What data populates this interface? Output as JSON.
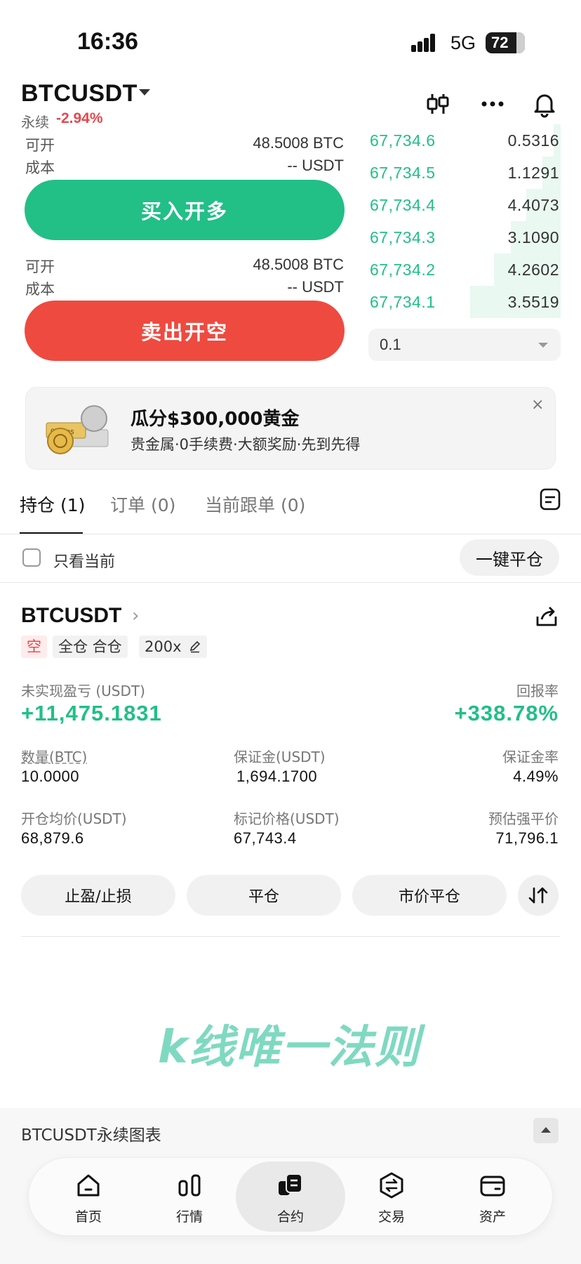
{
  "status_bar": {
    "time": "16:36",
    "network": "5G",
    "battery": "72"
  },
  "header": {
    "pair": "BTCUSDT",
    "contract_type": "永续",
    "change": "-2.94%"
  },
  "order_panel": {
    "buy": {
      "open_label": "可开",
      "open_value": "48.5008 BTC",
      "cost_label": "成本",
      "cost_value": "-- USDT",
      "button": "买入开多"
    },
    "sell": {
      "open_label": "可开",
      "open_value": "48.5008 BTC",
      "cost_label": "成本",
      "cost_value": "-- USDT",
      "button": "卖出开空"
    }
  },
  "order_book": {
    "rows": [
      {
        "price": "67,734.6",
        "qty": "0.5316",
        "depth": 0.08
      },
      {
        "price": "67,734.5",
        "qty": "1.1291",
        "depth": 0.2
      },
      {
        "price": "67,734.4",
        "qty": "4.4073",
        "depth": 0.38
      },
      {
        "price": "67,734.3",
        "qty": "3.1090",
        "depth": 0.55
      },
      {
        "price": "67,734.2",
        "qty": "4.2602",
        "depth": 0.74
      },
      {
        "price": "67,734.1",
        "qty": "3.5519",
        "depth": 1.0
      }
    ],
    "depth_step": "0.1"
  },
  "banner": {
    "title": "瓜分$300,000黄金",
    "subtitle": "贵金属·0手续费·大额奖励·先到先得",
    "close": "×",
    "image_text": "0 Fees"
  },
  "tabs": [
    {
      "label": "持仓 (1)",
      "active": true
    },
    {
      "label": "订单 (0)",
      "active": false
    },
    {
      "label": "当前跟单 (0)",
      "active": false
    }
  ],
  "filter": {
    "only_current": "只看当前",
    "close_all": "一键平仓"
  },
  "position": {
    "pair": "BTCUSDT",
    "tags": {
      "side": "空",
      "margin_mode": "全仓 合仓",
      "leverage": "200x"
    },
    "pnl_label": "未实现盈亏 (USDT)",
    "pnl_value": "+11,475.1831",
    "roe_label": "回报率",
    "roe_value": "+338.78%",
    "size_label": "数量(BTC)",
    "size_value": "10.0000",
    "margin_label": "保证金(USDT)",
    "margin_value": "1,694.1700",
    "margin_ratio_label": "保证金率",
    "margin_ratio_value": "4.49%",
    "entry_label": "开仓均价(USDT)",
    "entry_value": "68,879.6",
    "mark_label": "标记价格(USDT)",
    "mark_value": "67,743.4",
    "liq_label": "预估强平价",
    "liq_value": "71,796.1",
    "actions": {
      "tpsl": "止盈/止损",
      "close": "平仓",
      "market_close": "市价平仓"
    }
  },
  "watermark": "k线唯一法则",
  "chart_bar": {
    "label": "BTCUSDT永续图表"
  },
  "nav": [
    {
      "label": "首页",
      "icon": "home-icon"
    },
    {
      "label": "行情",
      "icon": "market-icon"
    },
    {
      "label": "合约",
      "icon": "futures-icon",
      "active": true
    },
    {
      "label": "交易",
      "icon": "trade-icon"
    },
    {
      "label": "资产",
      "icon": "wallet-icon"
    }
  ],
  "colors": {
    "green": "#22bf87",
    "red": "#ee4a40",
    "loss": "#e5484d"
  }
}
